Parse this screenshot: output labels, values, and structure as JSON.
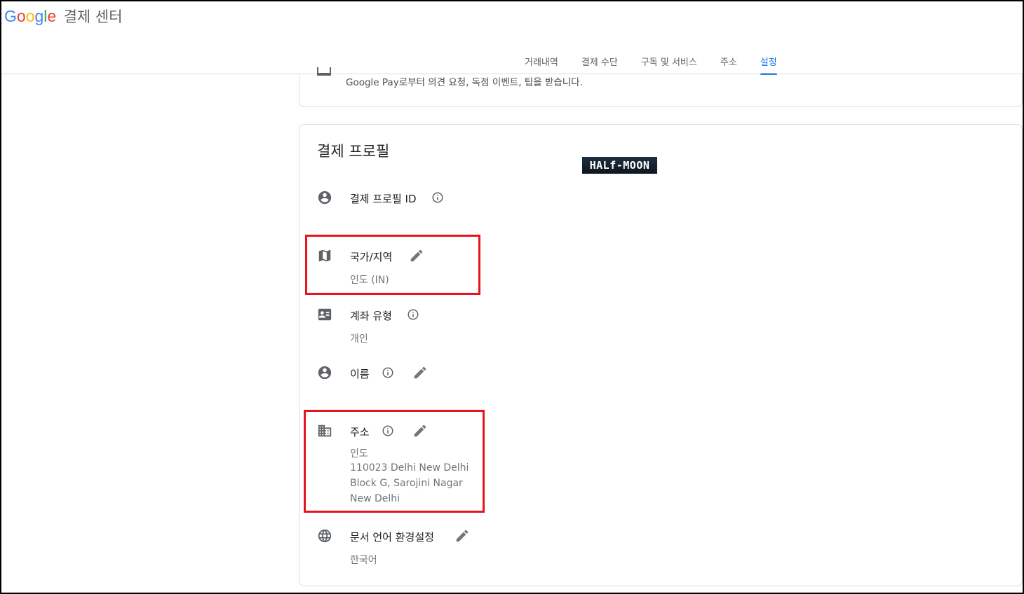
{
  "header": {
    "logo_letters": [
      "G",
      "o",
      "o",
      "g",
      "l",
      "e"
    ],
    "title": "결제 센터",
    "tabs": [
      {
        "label": "거래내역"
      },
      {
        "label": "결제 수단"
      },
      {
        "label": "구독 및 서비스"
      },
      {
        "label": "주소"
      },
      {
        "label": "설정"
      }
    ],
    "active_tab": "설정"
  },
  "prev_card": {
    "description": "Google Pay로부터 의견 요청, 독점 이벤트, 팁을 받습니다."
  },
  "watermark": "HALf-MOON",
  "profile": {
    "title": "결제 프로필",
    "profile_id_label": "결제 프로필 ID",
    "country_label": "국가/지역",
    "country_value": "인도 (IN)",
    "account_type_label": "계좌 유형",
    "account_type_value": "개인",
    "name_label": "이름",
    "address_label": "주소",
    "address_lines": [
      "인도",
      "110023 Delhi New Delhi",
      "Block G, Sarojini Nagar",
      "New Delhi"
    ],
    "doc_language_label": "문서 언어 환경설정",
    "doc_language_value": "한국어"
  },
  "colors": {
    "accent": "#1a73e8",
    "highlight_box": "#e8141b",
    "icon": "#5f6368"
  }
}
